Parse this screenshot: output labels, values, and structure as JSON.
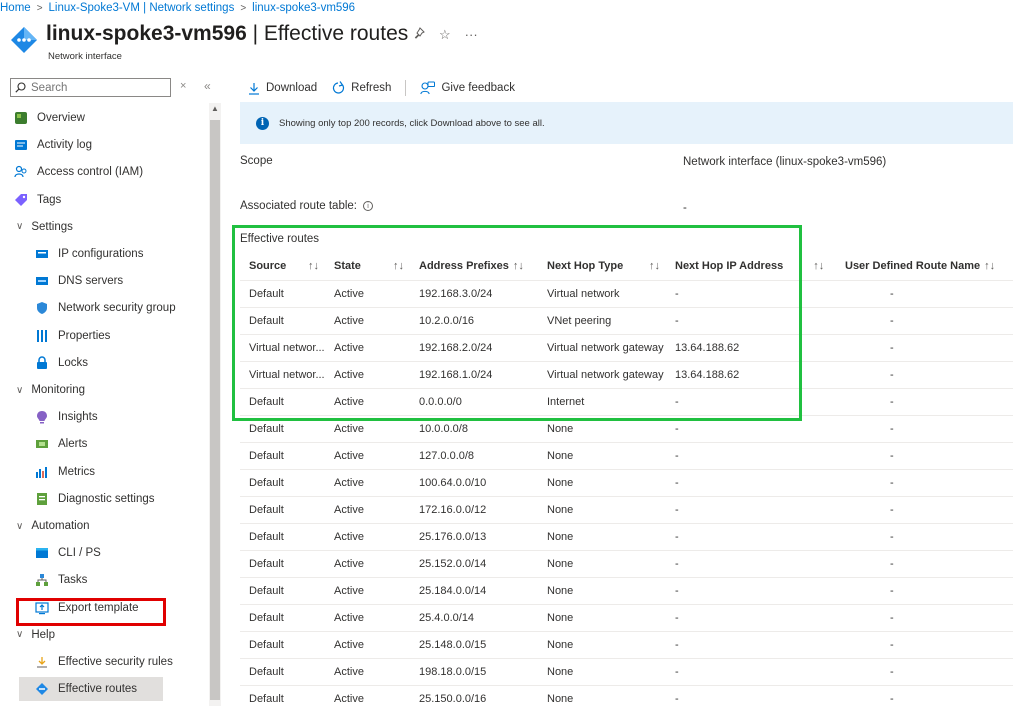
{
  "breadcrumb": {
    "items": [
      "Home",
      "Linux-Spoke3-VM | Network settings",
      "linux-spoke3-vm596"
    ],
    "separator": ">"
  },
  "header": {
    "resource_name": "linux-spoke3-vm596",
    "page_name": "Effective routes",
    "separator": " | ",
    "subtitle": "Network interface",
    "pin_icon": "☆",
    "star_icon": "☆",
    "more_icon": "···"
  },
  "sidebar": {
    "search_placeholder": "Search",
    "close_glyph": "×",
    "collapse_glyph": "«",
    "items": [
      {
        "label": "Overview",
        "icon": "overview-icon",
        "level": 0
      },
      {
        "label": "Activity log",
        "icon": "activity-log-icon",
        "level": 0
      },
      {
        "label": "Access control (IAM)",
        "icon": "iam-icon",
        "level": 0
      },
      {
        "label": "Tags",
        "icon": "tag-icon",
        "level": 0
      },
      {
        "label": "Settings",
        "icon": "chevron-down-icon",
        "level": "group"
      },
      {
        "label": "IP configurations",
        "icon": "ip-config-icon",
        "level": 1
      },
      {
        "label": "DNS servers",
        "icon": "dns-icon",
        "level": 1
      },
      {
        "label": "Network security group",
        "icon": "shield-icon",
        "level": 1
      },
      {
        "label": "Properties",
        "icon": "properties-icon",
        "level": 1
      },
      {
        "label": "Locks",
        "icon": "lock-icon",
        "level": 1
      },
      {
        "label": "Monitoring",
        "icon": "chevron-down-icon",
        "level": "group"
      },
      {
        "label": "Insights",
        "icon": "insights-icon",
        "level": 1
      },
      {
        "label": "Alerts",
        "icon": "alerts-icon",
        "level": 1
      },
      {
        "label": "Metrics",
        "icon": "metrics-icon",
        "level": 1
      },
      {
        "label": "Diagnostic settings",
        "icon": "diagnostic-icon",
        "level": 1
      },
      {
        "label": "Automation",
        "icon": "chevron-down-icon",
        "level": "group"
      },
      {
        "label": "CLI / PS",
        "icon": "cli-icon",
        "level": 1
      },
      {
        "label": "Tasks",
        "icon": "tasks-icon",
        "level": 1
      },
      {
        "label": "Export template",
        "icon": "export-icon",
        "level": 1
      },
      {
        "label": "Help",
        "icon": "chevron-down-icon",
        "level": "group"
      },
      {
        "label": "Effective security rules",
        "icon": "security-rules-icon",
        "level": 1
      },
      {
        "label": "Effective routes",
        "icon": "routes-icon",
        "level": 1,
        "selected": true
      }
    ]
  },
  "toolbar": {
    "download": "Download",
    "refresh": "Refresh",
    "feedback": "Give feedback"
  },
  "info": {
    "icon": "i",
    "message": "Showing only top 200 records, click Download above to see all."
  },
  "details": {
    "scope_label": "Scope",
    "scope_value": "Network interface (linux-spoke3-vm596)",
    "route_table_label": "Associated route table:",
    "route_table_value": "-"
  },
  "routes": {
    "title": "Effective routes",
    "sort_glyph": "↑↓",
    "columns": [
      "Source",
      "State",
      "Address Prefixes",
      "Next Hop Type",
      "Next Hop IP Address",
      "User Defined Route Name"
    ],
    "rows": [
      [
        "Default",
        "Active",
        "192.168.3.0/24",
        "Virtual network",
        "-",
        "-"
      ],
      [
        "Default",
        "Active",
        "10.2.0.0/16",
        "VNet peering",
        "-",
        "-"
      ],
      [
        "Virtual networ...",
        "Active",
        "192.168.2.0/24",
        "Virtual network gateway",
        "13.64.188.62",
        "-"
      ],
      [
        "Virtual networ...",
        "Active",
        "192.168.1.0/24",
        "Virtual network gateway",
        "13.64.188.62",
        "-"
      ],
      [
        "Default",
        "Active",
        "0.0.0.0/0",
        "Internet",
        "-",
        "-"
      ],
      [
        "Default",
        "Active",
        "10.0.0.0/8",
        "None",
        "-",
        "-"
      ],
      [
        "Default",
        "Active",
        "127.0.0.0/8",
        "None",
        "-",
        "-"
      ],
      [
        "Default",
        "Active",
        "100.64.0.0/10",
        "None",
        "-",
        "-"
      ],
      [
        "Default",
        "Active",
        "172.16.0.0/12",
        "None",
        "-",
        "-"
      ],
      [
        "Default",
        "Active",
        "25.176.0.0/13",
        "None",
        "-",
        "-"
      ],
      [
        "Default",
        "Active",
        "25.152.0.0/14",
        "None",
        "-",
        "-"
      ],
      [
        "Default",
        "Active",
        "25.184.0.0/14",
        "None",
        "-",
        "-"
      ],
      [
        "Default",
        "Active",
        "25.4.0.0/14",
        "None",
        "-",
        "-"
      ],
      [
        "Default",
        "Active",
        "25.148.0.0/15",
        "None",
        "-",
        "-"
      ],
      [
        "Default",
        "Active",
        "198.18.0.0/15",
        "None",
        "-",
        "-"
      ],
      [
        "Default",
        "Active",
        "25.150.0.0/16",
        "None",
        "-",
        "-"
      ]
    ]
  },
  "colors": {
    "accent": "#0078d4",
    "info_bg": "#e6f2fb",
    "highlight_green": "#20c040",
    "highlight_red": "#e00000"
  }
}
